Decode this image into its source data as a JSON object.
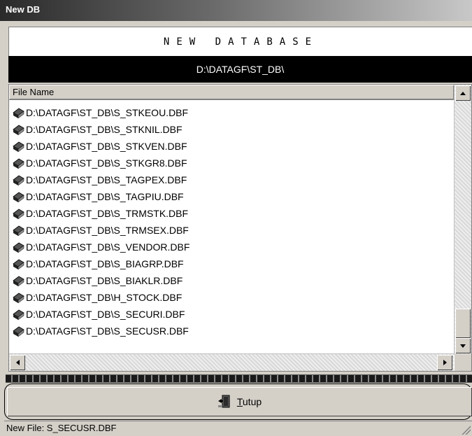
{
  "window": {
    "title": "New DB"
  },
  "heading": "NEW DATABASE",
  "path": "D:\\DATAGF\\ST_DB\\",
  "list": {
    "header": "File Name",
    "rows": [
      "D:\\DATAGF\\ST_DB\\S_STKEOU.DBF",
      "D:\\DATAGF\\ST_DB\\S_STKNIL.DBF",
      "D:\\DATAGF\\ST_DB\\S_STKVEN.DBF",
      "D:\\DATAGF\\ST_DB\\S_STKGR8.DBF",
      "D:\\DATAGF\\ST_DB\\S_TAGPEX.DBF",
      "D:\\DATAGF\\ST_DB\\S_TAGPIU.DBF",
      "D:\\DATAGF\\ST_DB\\S_TRMSTK.DBF",
      "D:\\DATAGF\\ST_DB\\S_TRMSEX.DBF",
      "D:\\DATAGF\\ST_DB\\S_VENDOR.DBF",
      "D:\\DATAGF\\ST_DB\\S_BIAGRP.DBF",
      "D:\\DATAGF\\ST_DB\\S_BIAKLR.DBF",
      "D:\\DATAGF\\ST_DB\\H_STOCK.DBF",
      "D:\\DATAGF\\ST_DB\\S_SECURI.DBF",
      "D:\\DATAGF\\ST_DB\\S_SECUSR.DBF"
    ],
    "row_icon": "database-file-icon"
  },
  "progress": {
    "value": 1.0
  },
  "button": {
    "label_underlined": "T",
    "label_rest": "utup",
    "icon": "exit-door-icon"
  },
  "status": "New File: S_SECUSR.DBF"
}
